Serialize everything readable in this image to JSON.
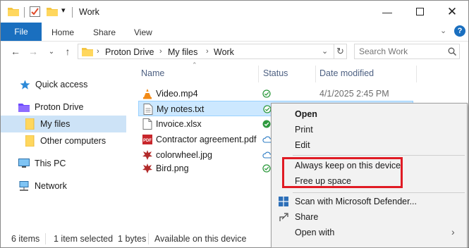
{
  "window": {
    "title": "Work"
  },
  "ribbon": {
    "tabs": [
      "File",
      "Home",
      "Share",
      "View"
    ]
  },
  "address": {
    "segments": [
      "Proton Drive",
      "My files",
      "Work"
    ]
  },
  "search": {
    "placeholder": "Search Work"
  },
  "nav": {
    "items": [
      {
        "label": "Quick access",
        "icon": "star-icon"
      },
      {
        "label": "Proton Drive",
        "icon": "proton-drive-icon"
      },
      {
        "label": "My files",
        "icon": "folder-icon",
        "selected": true
      },
      {
        "label": "Other computers",
        "icon": "folder-icon"
      },
      {
        "label": "This PC",
        "icon": "pc-icon"
      },
      {
        "label": "Network",
        "icon": "network-icon"
      }
    ]
  },
  "columns": {
    "name": "Name",
    "status": "Status",
    "date": "Date modified"
  },
  "files": [
    {
      "name": "Video.mp4",
      "icon": "vlc-icon",
      "status": "synced",
      "date": "4/1/2025 2:45 PM"
    },
    {
      "name": "My notes.txt",
      "icon": "text-file-icon",
      "status": "synced",
      "date": ""
    },
    {
      "name": "Invoice.xlsx",
      "icon": "file-icon",
      "status": "available-offline",
      "date": ""
    },
    {
      "name": "Contractor agreement.pdf",
      "icon": "pdf-icon",
      "status": "cloud",
      "date": ""
    },
    {
      "name": "colorwheel.jpg",
      "icon": "image-icon",
      "status": "cloud",
      "date": ""
    },
    {
      "name": "Bird.png",
      "icon": "image-icon",
      "status": "synced",
      "date": ""
    }
  ],
  "statusbar": {
    "items": "6 items",
    "selected": "1 item selected  1 bytes",
    "availability": "Available on this device"
  },
  "menu": {
    "open": "Open",
    "print": "Print",
    "edit": "Edit",
    "keep": "Always keep on this device",
    "free": "Free up space",
    "scan": "Scan with Microsoft Defender...",
    "share": "Share",
    "open_with": "Open with"
  },
  "colors": {
    "accent": "#1a6fbf",
    "highlight": "#e01b24",
    "selection": "#cce8ff"
  }
}
